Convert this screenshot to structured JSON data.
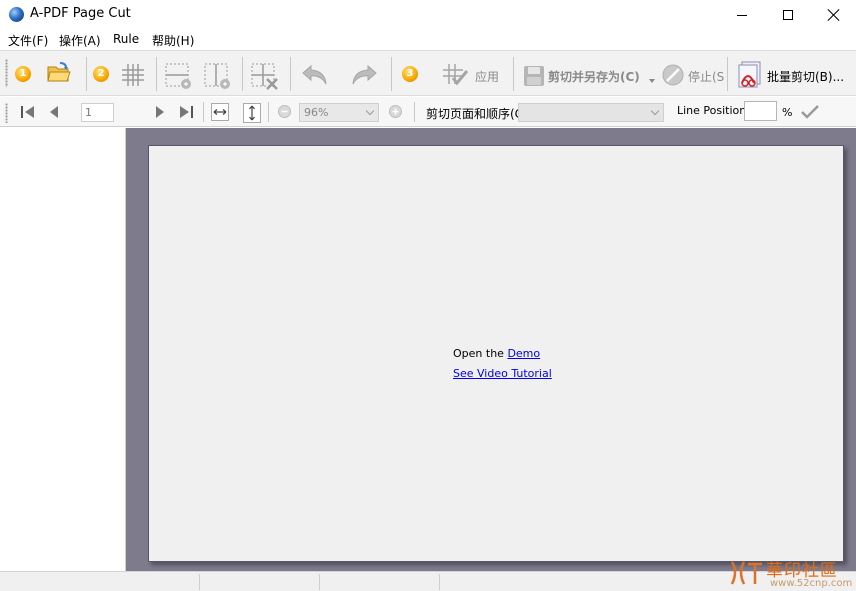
{
  "window": {
    "title": "A-PDF Page Cut"
  },
  "menu": {
    "file": "文件(F)",
    "operate": "操作(A)",
    "rule": "Rule",
    "help": "帮助(H)"
  },
  "toolbar": {
    "step1": "1",
    "step2": "2",
    "step3": "3",
    "apply_label": "应用",
    "cut_save_label": "剪切并另存为(C)",
    "stop_label": "停止(S",
    "batch_label": "批量剪切(B)..."
  },
  "navbar": {
    "page_value": "1",
    "zoom_value": "96%",
    "order_label": "剪切页面和顺序(C",
    "order_value": "",
    "line_position_label": "Line Position:",
    "line_position_value": "",
    "percent_label": "%"
  },
  "document": {
    "open_text": "Open the",
    "demo_link": "Demo",
    "tutorial_link": "See Video Tutorial"
  },
  "watermark": {
    "text": "華印社區",
    "url": "www.52cnp.com"
  },
  "colors": {
    "canvas_bg": "#7d7b8c",
    "page_bg": "#f0f0f0",
    "link": "#0000ee",
    "step_badge": "#f7a600"
  }
}
